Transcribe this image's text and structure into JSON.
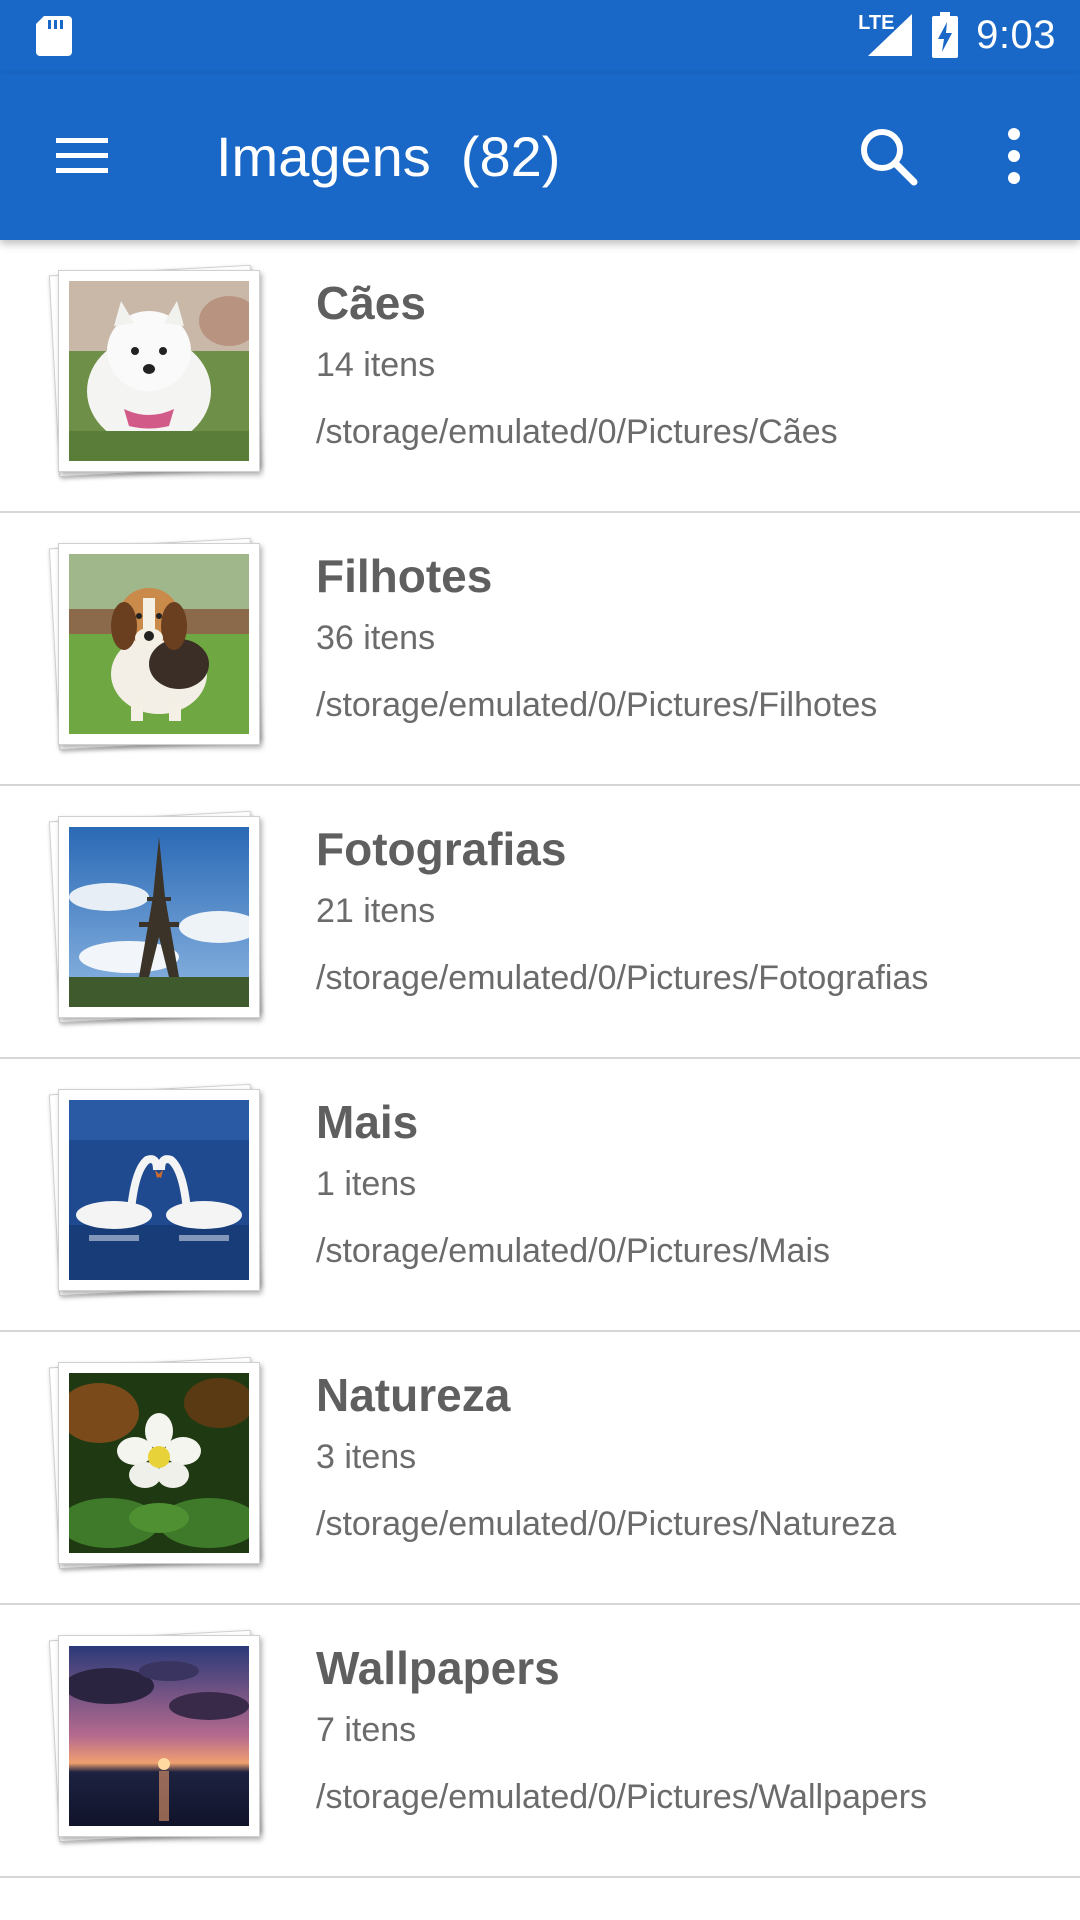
{
  "status_bar": {
    "time": "9:03",
    "network": "LTE",
    "icons": [
      "sd-card-icon",
      "signal-icon",
      "battery-charging-icon"
    ]
  },
  "toolbar": {
    "title": "Imagens",
    "count": "(82)",
    "icons": [
      "menu-icon",
      "search-icon",
      "more-vert-icon"
    ]
  },
  "albums": [
    {
      "name": "Cães",
      "count": "14 itens",
      "path": "/storage/emulated/0/Pictures/Cães",
      "thumbnail": "puppy-white"
    },
    {
      "name": "Filhotes",
      "count": "36 itens",
      "path": "/storage/emulated/0/Pictures/Filhotes",
      "thumbnail": "beagle-puppy"
    },
    {
      "name": "Fotografias",
      "count": "21 itens",
      "path": "/storage/emulated/0/Pictures/Fotografias",
      "thumbnail": "eiffel-tower"
    },
    {
      "name": "Mais",
      "count": "1 itens",
      "path": "/storage/emulated/0/Pictures/Mais",
      "thumbnail": "swans"
    },
    {
      "name": "Natureza",
      "count": "3 itens",
      "path": "/storage/emulated/0/Pictures/Natureza",
      "thumbnail": "white-flower"
    },
    {
      "name": "Wallpapers",
      "count": "7 itens",
      "path": "/storage/emulated/0/Pictures/Wallpapers",
      "thumbnail": "sunset-sea"
    }
  ],
  "colors": {
    "primary": "#1967c6",
    "text_primary": "#5f5f5f",
    "divider": "#d6d6d6"
  }
}
